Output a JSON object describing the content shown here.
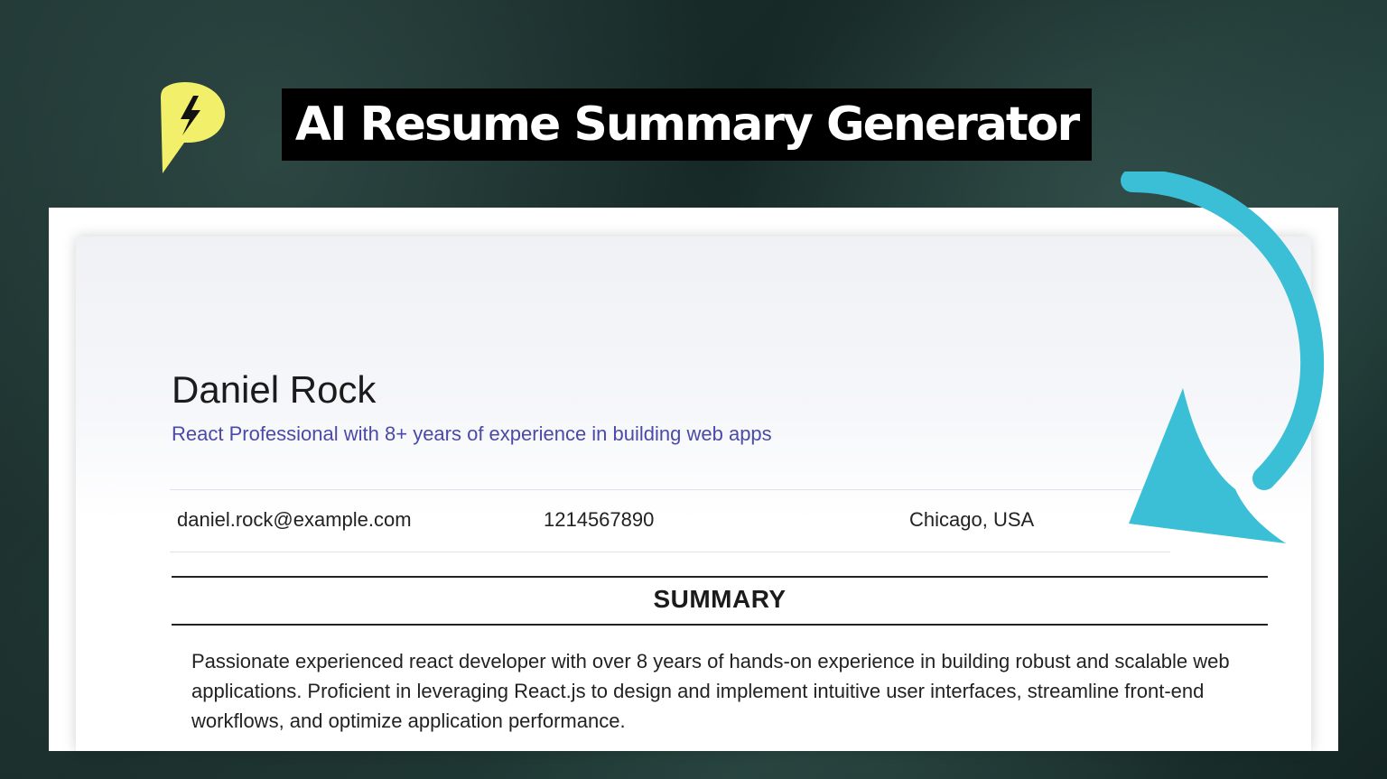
{
  "banner": {
    "title": "AI Resume Summary Generator",
    "logo_icon": "bolt-chat-bubble-icon",
    "logo_color": "#f2f06a"
  },
  "resume": {
    "name": "Daniel Rock",
    "headline": "React Professional with 8+ years of experience in building web apps",
    "contact": {
      "email": "daniel.rock@example.com",
      "phone": "1214567890",
      "location": "Chicago, USA"
    },
    "section_title": "SUMMARY",
    "summary": "Passionate experienced react developer with over 8 years of hands-on experience in building robust and scalable web applications. Proficient in leveraging React.js to design and implement intuitive user interfaces, streamline front-end workflows, and optimize application performance."
  },
  "colors": {
    "headline": "#4a4aa8",
    "arrow": "#3bbfd6"
  },
  "decorations": {
    "arrow_icon": "curved-arrow-down-icon"
  }
}
